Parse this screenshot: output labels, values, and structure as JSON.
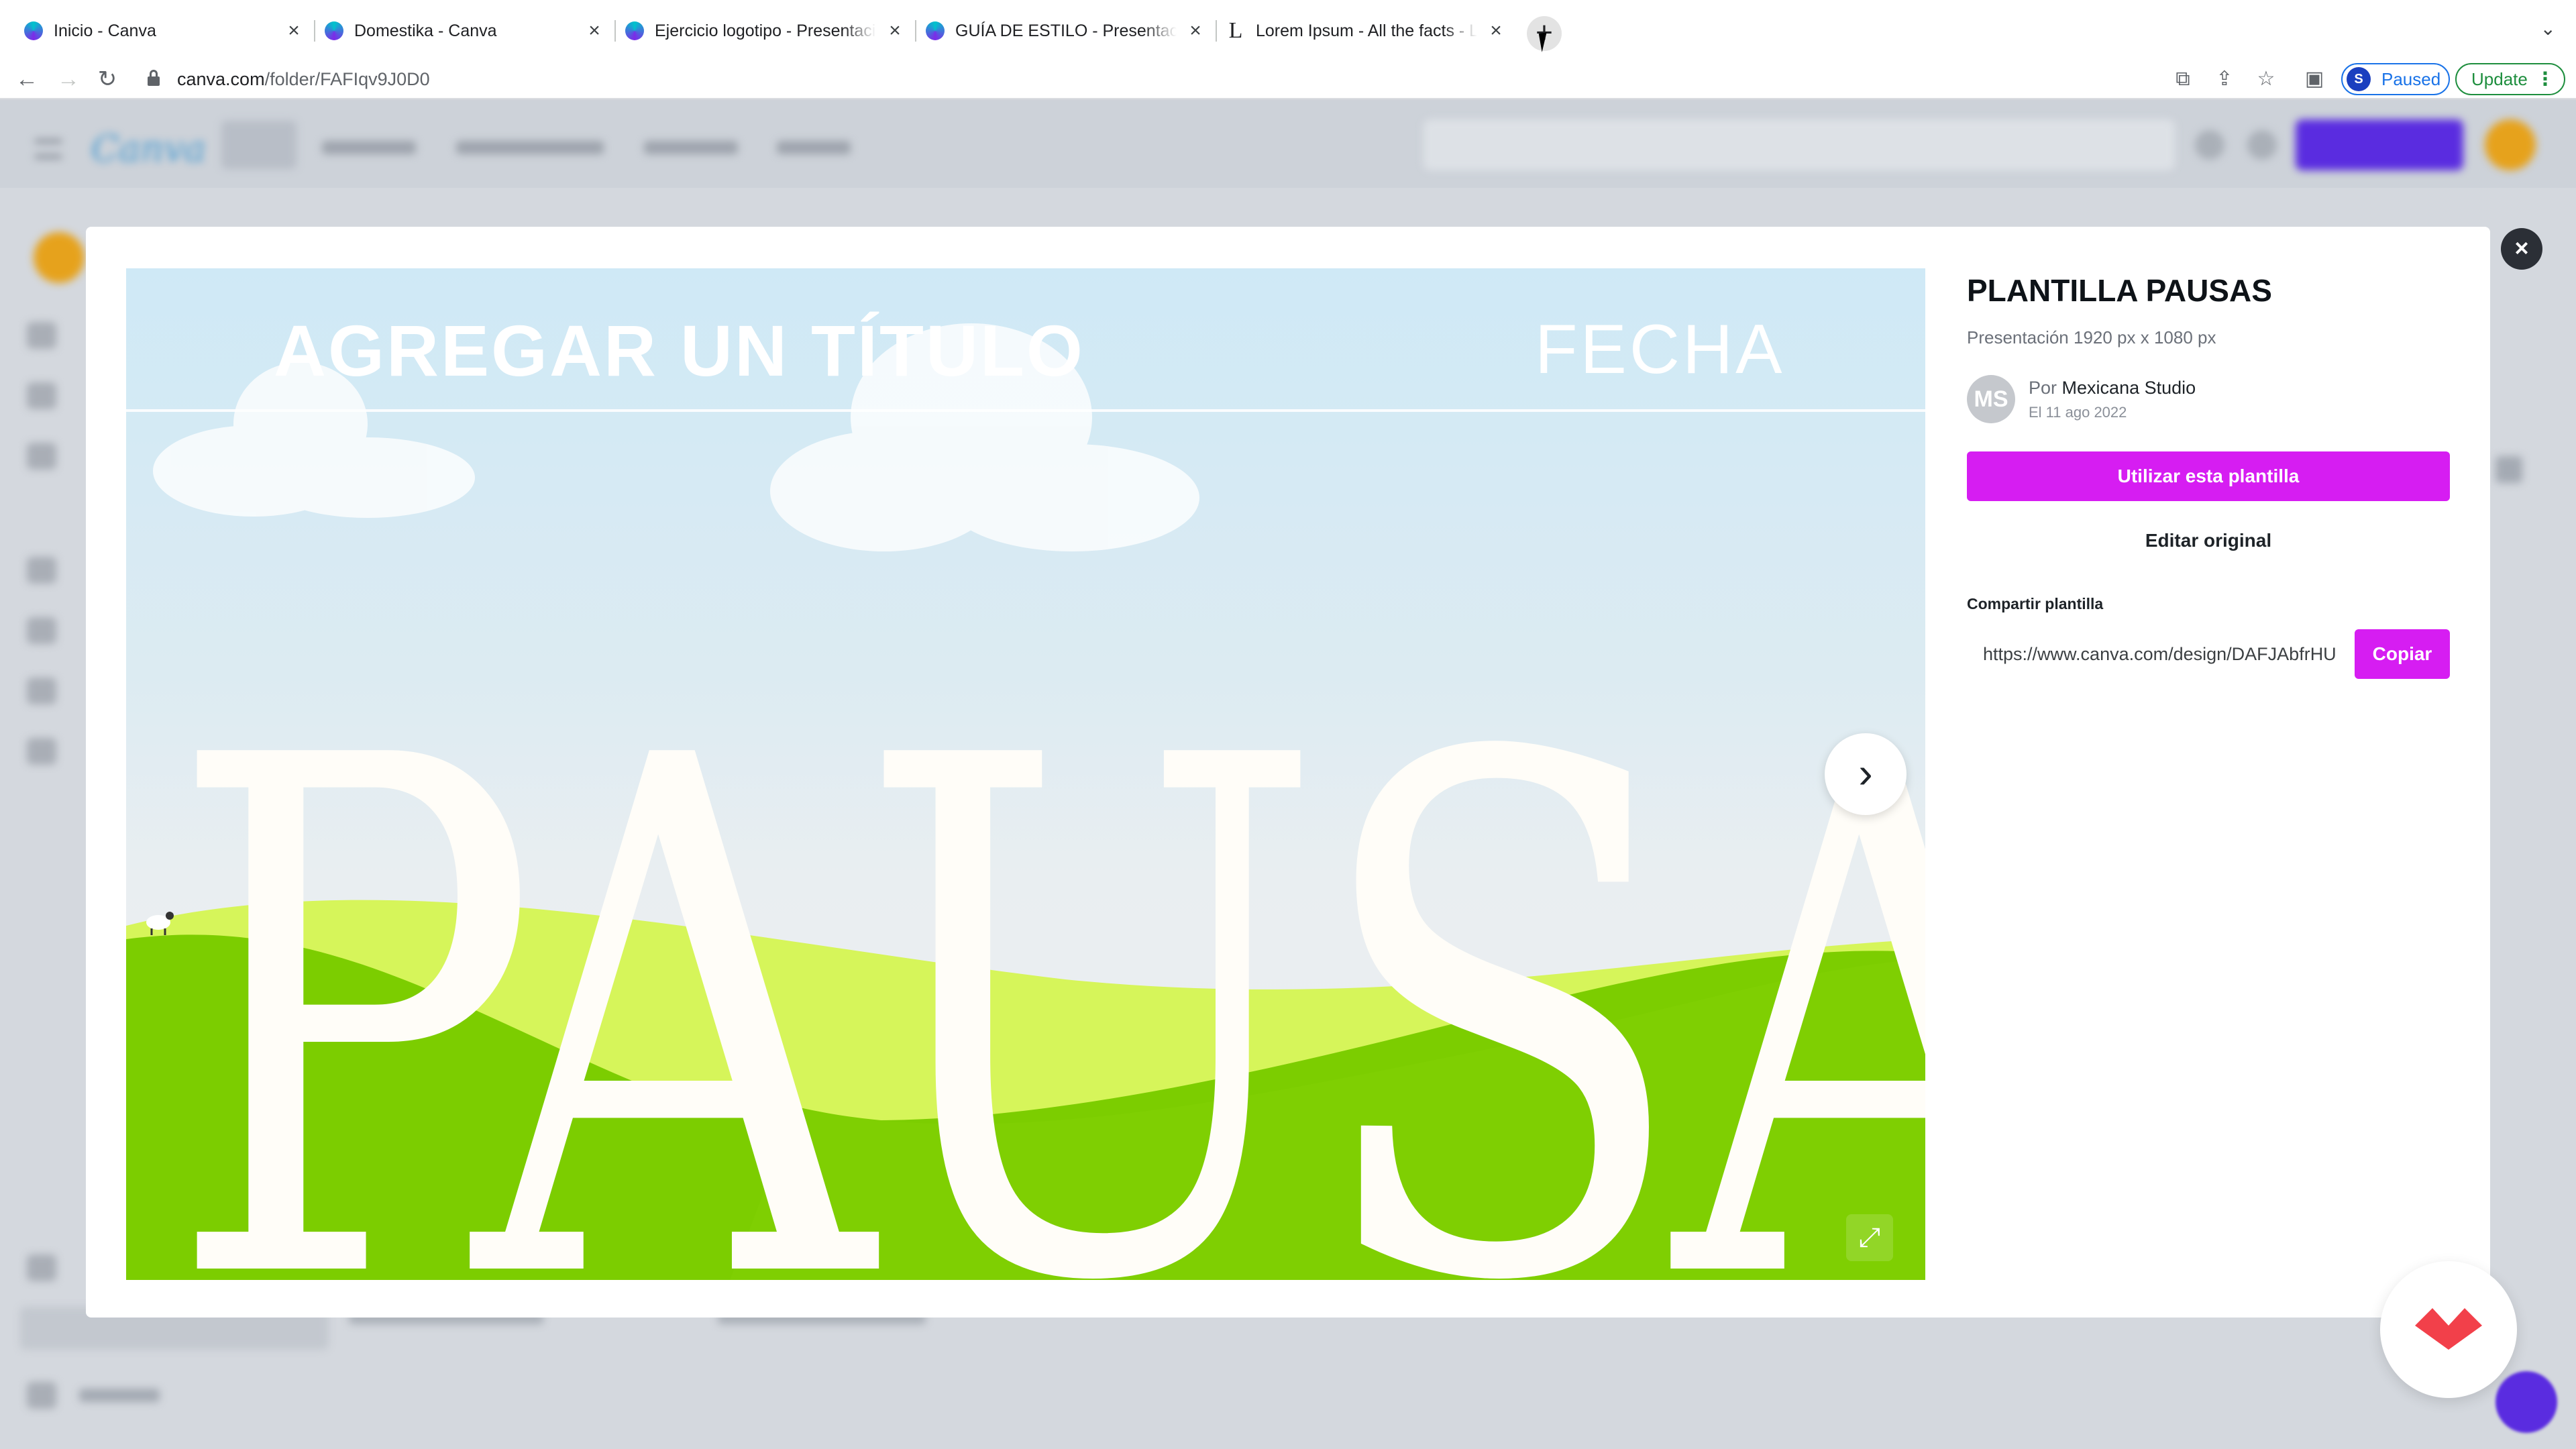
{
  "browser": {
    "tabs": [
      {
        "title": "Inicio - Canva",
        "favicon": "canva-icon"
      },
      {
        "title": "Domestika - Canva",
        "favicon": "canva-icon"
      },
      {
        "title": "Ejercicio logotipo - Presentación",
        "favicon": "canva-icon"
      },
      {
        "title": "GUÍA DE ESTILO - Presentación",
        "favicon": "canva-icon"
      },
      {
        "title": "Lorem Ipsum - All the facts - Lipsum",
        "favicon": "lipsum-icon"
      }
    ],
    "url_domain": "canva.com",
    "url_path": "/folder/FAFIqv9J0D0",
    "profile_initial": "S",
    "profile_status": "Paused",
    "update_label": "Update"
  },
  "modal": {
    "template_title": "PLANTILLA PAUSAS",
    "template_subtitle": "Presentación 1920 px x 1080 px",
    "author_initials": "MS",
    "author_prefix": "Por",
    "author_name": "Mexicana Studio",
    "author_date": "El 11 ago 2022",
    "use_template_label": "Utilizar esta plantilla",
    "edit_original_label": "Editar original",
    "share_label": "Compartir plantilla",
    "share_url": "https://www.canva.com/design/DAFJAbfrHU",
    "copy_label": "Copiar",
    "close_icon": "×",
    "preview": {
      "title_text": "AGREGAR UN TÍTULO",
      "date_text": "FECHA",
      "big_word": "PAUSAS",
      "next_icon": "›",
      "expand_icon": "⤢"
    }
  },
  "colors": {
    "accent_magenta": "#d61df2",
    "canva_purple": "#5a2ce0",
    "grass_green": "#7ccd00",
    "lime_green": "#d6f55a"
  }
}
